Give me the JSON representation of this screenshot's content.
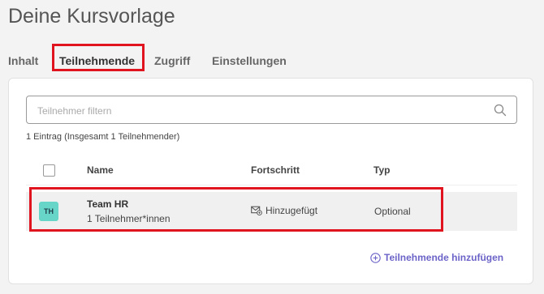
{
  "page": {
    "title": "Deine Kursvorlage"
  },
  "tabs": [
    {
      "label": "Inhalt"
    },
    {
      "label": "Teilnehmende",
      "active": true
    },
    {
      "label": "Zugriff"
    },
    {
      "label": "Einstellungen"
    }
  ],
  "search": {
    "placeholder": "Teilnehmer filtern",
    "value": "",
    "icon": "search-icon"
  },
  "summary": "1 Eintrag (Insgesamt 1 Teilnehmender)",
  "table": {
    "headers": {
      "name": "Name",
      "progress": "Fortschritt",
      "type": "Typ"
    },
    "rows": [
      {
        "initials": "TH",
        "name": "Team HR",
        "sub": "1 Teilnehmer*innen",
        "progress": "Hinzugefügt",
        "type": "Optional"
      }
    ]
  },
  "actions": {
    "add_participants": "Teilnehmende hinzufügen"
  },
  "colors": {
    "highlight": "#e0141e",
    "avatar_bg": "#67d5c8",
    "link": "#6b63c8"
  }
}
